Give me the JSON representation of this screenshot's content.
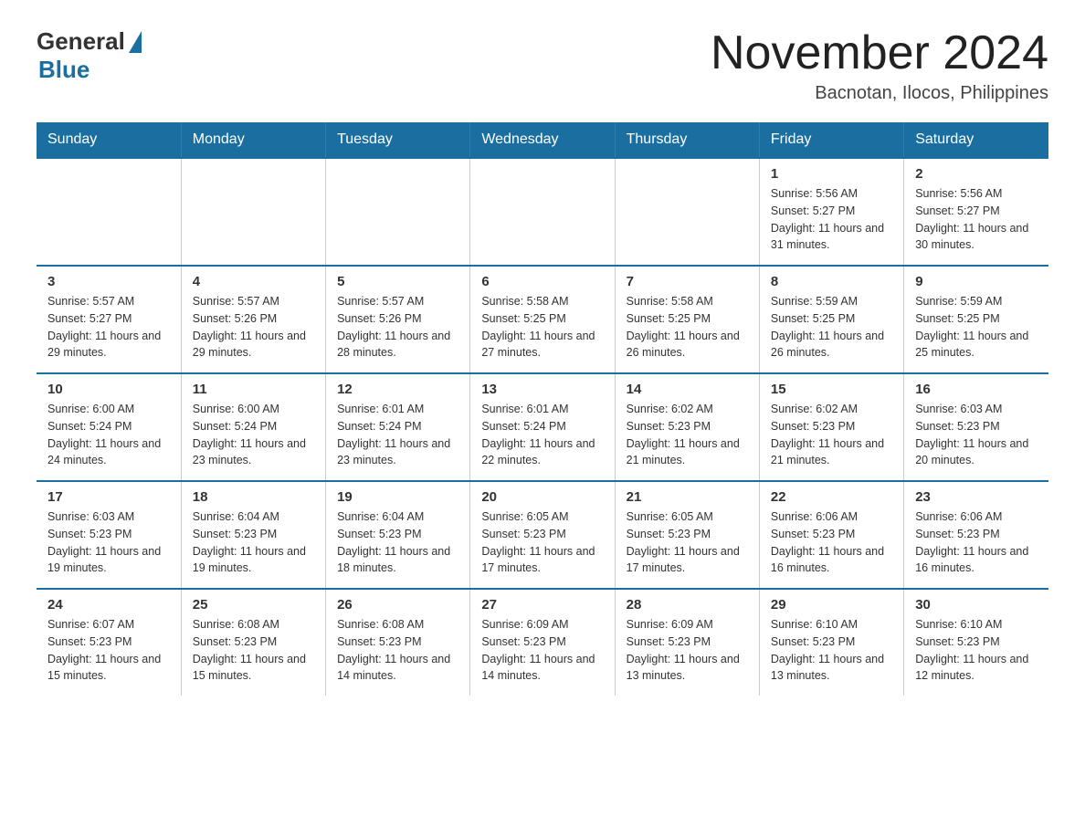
{
  "logo": {
    "general": "General",
    "blue": "Blue"
  },
  "title": "November 2024",
  "subtitle": "Bacnotan, Ilocos, Philippines",
  "days_of_week": [
    "Sunday",
    "Monday",
    "Tuesday",
    "Wednesday",
    "Thursday",
    "Friday",
    "Saturday"
  ],
  "weeks": [
    [
      {
        "day": "",
        "info": ""
      },
      {
        "day": "",
        "info": ""
      },
      {
        "day": "",
        "info": ""
      },
      {
        "day": "",
        "info": ""
      },
      {
        "day": "",
        "info": ""
      },
      {
        "day": "1",
        "info": "Sunrise: 5:56 AM\nSunset: 5:27 PM\nDaylight: 11 hours and 31 minutes."
      },
      {
        "day": "2",
        "info": "Sunrise: 5:56 AM\nSunset: 5:27 PM\nDaylight: 11 hours and 30 minutes."
      }
    ],
    [
      {
        "day": "3",
        "info": "Sunrise: 5:57 AM\nSunset: 5:27 PM\nDaylight: 11 hours and 29 minutes."
      },
      {
        "day": "4",
        "info": "Sunrise: 5:57 AM\nSunset: 5:26 PM\nDaylight: 11 hours and 29 minutes."
      },
      {
        "day": "5",
        "info": "Sunrise: 5:57 AM\nSunset: 5:26 PM\nDaylight: 11 hours and 28 minutes."
      },
      {
        "day": "6",
        "info": "Sunrise: 5:58 AM\nSunset: 5:25 PM\nDaylight: 11 hours and 27 minutes."
      },
      {
        "day": "7",
        "info": "Sunrise: 5:58 AM\nSunset: 5:25 PM\nDaylight: 11 hours and 26 minutes."
      },
      {
        "day": "8",
        "info": "Sunrise: 5:59 AM\nSunset: 5:25 PM\nDaylight: 11 hours and 26 minutes."
      },
      {
        "day": "9",
        "info": "Sunrise: 5:59 AM\nSunset: 5:25 PM\nDaylight: 11 hours and 25 minutes."
      }
    ],
    [
      {
        "day": "10",
        "info": "Sunrise: 6:00 AM\nSunset: 5:24 PM\nDaylight: 11 hours and 24 minutes."
      },
      {
        "day": "11",
        "info": "Sunrise: 6:00 AM\nSunset: 5:24 PM\nDaylight: 11 hours and 23 minutes."
      },
      {
        "day": "12",
        "info": "Sunrise: 6:01 AM\nSunset: 5:24 PM\nDaylight: 11 hours and 23 minutes."
      },
      {
        "day": "13",
        "info": "Sunrise: 6:01 AM\nSunset: 5:24 PM\nDaylight: 11 hours and 22 minutes."
      },
      {
        "day": "14",
        "info": "Sunrise: 6:02 AM\nSunset: 5:23 PM\nDaylight: 11 hours and 21 minutes."
      },
      {
        "day": "15",
        "info": "Sunrise: 6:02 AM\nSunset: 5:23 PM\nDaylight: 11 hours and 21 minutes."
      },
      {
        "day": "16",
        "info": "Sunrise: 6:03 AM\nSunset: 5:23 PM\nDaylight: 11 hours and 20 minutes."
      }
    ],
    [
      {
        "day": "17",
        "info": "Sunrise: 6:03 AM\nSunset: 5:23 PM\nDaylight: 11 hours and 19 minutes."
      },
      {
        "day": "18",
        "info": "Sunrise: 6:04 AM\nSunset: 5:23 PM\nDaylight: 11 hours and 19 minutes."
      },
      {
        "day": "19",
        "info": "Sunrise: 6:04 AM\nSunset: 5:23 PM\nDaylight: 11 hours and 18 minutes."
      },
      {
        "day": "20",
        "info": "Sunrise: 6:05 AM\nSunset: 5:23 PM\nDaylight: 11 hours and 17 minutes."
      },
      {
        "day": "21",
        "info": "Sunrise: 6:05 AM\nSunset: 5:23 PM\nDaylight: 11 hours and 17 minutes."
      },
      {
        "day": "22",
        "info": "Sunrise: 6:06 AM\nSunset: 5:23 PM\nDaylight: 11 hours and 16 minutes."
      },
      {
        "day": "23",
        "info": "Sunrise: 6:06 AM\nSunset: 5:23 PM\nDaylight: 11 hours and 16 minutes."
      }
    ],
    [
      {
        "day": "24",
        "info": "Sunrise: 6:07 AM\nSunset: 5:23 PM\nDaylight: 11 hours and 15 minutes."
      },
      {
        "day": "25",
        "info": "Sunrise: 6:08 AM\nSunset: 5:23 PM\nDaylight: 11 hours and 15 minutes."
      },
      {
        "day": "26",
        "info": "Sunrise: 6:08 AM\nSunset: 5:23 PM\nDaylight: 11 hours and 14 minutes."
      },
      {
        "day": "27",
        "info": "Sunrise: 6:09 AM\nSunset: 5:23 PM\nDaylight: 11 hours and 14 minutes."
      },
      {
        "day": "28",
        "info": "Sunrise: 6:09 AM\nSunset: 5:23 PM\nDaylight: 11 hours and 13 minutes."
      },
      {
        "day": "29",
        "info": "Sunrise: 6:10 AM\nSunset: 5:23 PM\nDaylight: 11 hours and 13 minutes."
      },
      {
        "day": "30",
        "info": "Sunrise: 6:10 AM\nSunset: 5:23 PM\nDaylight: 11 hours and 12 minutes."
      }
    ]
  ]
}
